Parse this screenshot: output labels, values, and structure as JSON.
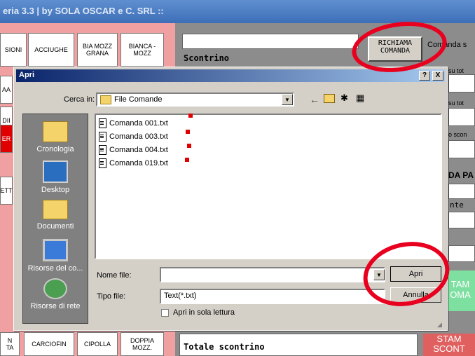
{
  "app": {
    "title": "eria 3.3 | by SOLA OSCAR e C. SRL ::"
  },
  "left_panel": {
    "top_buttons": [
      "SIONI",
      "ACCIUGHE",
      "BIA MOZZ\nGRANA",
      "BIANCA -\nMOZZ"
    ],
    "side_tabs": [
      "AA",
      "DII",
      "ER",
      "ETT"
    ],
    "bottom_buttons": [
      "N\nTA",
      "CARCIOFIN",
      "CIPOLLA",
      "DOPPIA\nMOZZ."
    ]
  },
  "right_panel": {
    "scontrino_label": "Scontrino",
    "richiama_button": "RICHIAMA\nCOMANDA",
    "comanda_label": "Comanda s",
    "su_tot_1": "su tot",
    "su_tot_2": "su tot",
    "sconto_label": "o scon",
    "da_pa_label": "DA PA",
    "nte_label": "nte",
    "stampa_1": "TAM\nOMA",
    "stampa_2": "STAM\nSCONT",
    "totale_label": "Totale scontrino"
  },
  "dialog": {
    "title": "Apri",
    "help_btn": "?",
    "close_btn": "X",
    "look_in_label": "Cerca in:",
    "look_in_value": "File Comande",
    "places": [
      {
        "label": "Cronologia",
        "icon": "history-folder-icon"
      },
      {
        "label": "Desktop",
        "icon": "desktop-icon"
      },
      {
        "label": "Documenti",
        "icon": "documents-folder-icon"
      },
      {
        "label": "Risorse del co...",
        "icon": "my-computer-icon"
      },
      {
        "label": "Risorse di rete",
        "icon": "network-places-icon"
      }
    ],
    "files": [
      "Comanda 001.txt",
      "Comanda 003.txt",
      "Comanda 004.txt",
      "Comanda 019.txt"
    ],
    "filename_label": "Nome file:",
    "filename_value": "",
    "filetype_label": "Tipo file:",
    "filetype_value": "Text(*.txt)",
    "readonly_label": "Apri in sola lettura",
    "open_button": "Apri",
    "cancel_button": "Annulla"
  },
  "colors": {
    "annotation": "#e8001e",
    "marker": "#e00000",
    "title_bar": "#0a246a"
  }
}
